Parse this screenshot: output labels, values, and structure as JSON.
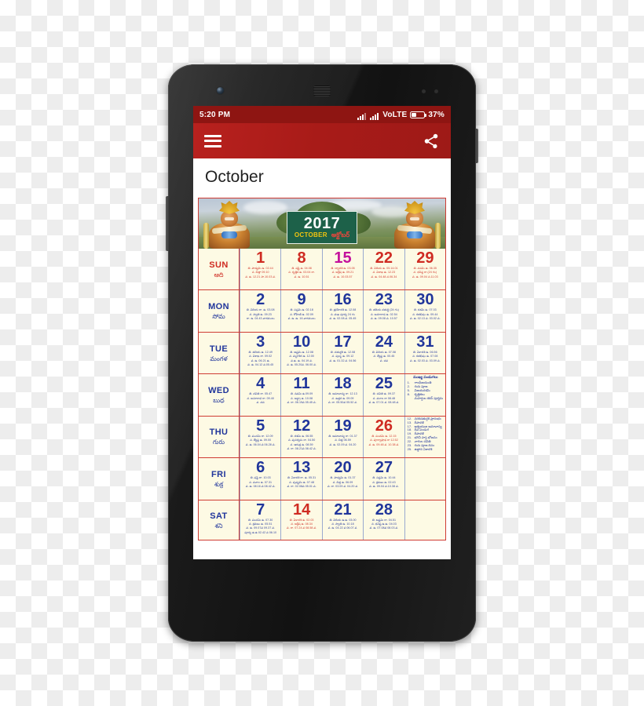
{
  "status_bar": {
    "time": "5:20 PM",
    "network_label": "VoLTE",
    "battery_percent": "37%",
    "signal_icon": "signal-bars-icon",
    "battery_icon": "battery-icon"
  },
  "app_bar": {
    "menu_icon": "hamburger-menu-icon",
    "share_icon": "share-icon",
    "background_color": "#b8211e"
  },
  "header": {
    "month_title": "October"
  },
  "banner": {
    "year": "2017",
    "month_english": "OCTOBER",
    "month_telugu": "అక్టోబర్",
    "left_deity": "hanuman-figure",
    "right_deity": "hanuman-figure",
    "plate_color": "#1d6149"
  },
  "calendar": {
    "border_color": "#cf3b33",
    "paper_color": "#fdfae4",
    "rows": [
      {
        "abbr": "SUN",
        "telugu": "ఆది",
        "label_color": "red",
        "cells": [
          {
            "date": "1",
            "color": "red",
            "lines": [
              "తి. పాడ్యమి ఉ. 02.44",
              "న. చిత్తా  09.10",
              "వ. ఉ. 12.21 సా.10.03 వ."
            ]
          },
          {
            "date": "8",
            "color": "red",
            "lines": [
              "తి. షష్టి  ఉ. 04.08",
              "న. కృత్తిక ఉ. 03.04 రా.",
              "వ. ఉ. 10.51"
            ]
          },
          {
            "date": "15",
            "color": "magenta",
            "lines": [
              "తి. ద్వాదశి ఉ. 03.05",
              "న. అశ్లేష ఉ. 09.21",
              "వ. ఉ. 10.03.57"
            ]
          },
          {
            "date": "22",
            "color": "red",
            "lines": [
              "తి. విదియ  ఉ. 05.14.01",
              "న. విశాఖ ఉ. 12.23",
              "వ. ఉ. 04.48 న.06.34"
            ]
          },
          {
            "date": "29",
            "color": "red",
            "lines": [
              "తి. నవమి ఉ. 06.35",
              "న. ధనిష్ఠ రా.(24 గం)",
              "వ. ఉ. 09.04 న.11.03"
            ]
          }
        ]
      },
      {
        "abbr": "MON",
        "telugu": "సోమ",
        "label_color": "blue",
        "cells": [
          {
            "date": "2",
            "color": "blue",
            "lines": [
              "తి. విదియ  రా. ఉ. 03.08",
              "న. స్వాతి ఉ. 09.23",
              "రా. ఉ. 04.43 వారములు"
            ]
          },
          {
            "date": "9",
            "color": "blue",
            "lines": [
              "తి. సప్తమి ఉ. 02.18",
              "న. రోహిణి ఉ. 02.09",
              "వ. ఉ. ఉ. 16 వారములు"
            ]
          },
          {
            "date": "16",
            "color": "blue",
            "lines": [
              "తి. త్రయోదశి ఉ. 12.08",
              "న. మఖ పూర్వ 24 గం",
              "వ. ఉ. 02.08 వ. 05.45"
            ]
          },
          {
            "date": "23",
            "color": "blue",
            "lines": [
              "తి. తదియ చతుర్థి  (24 గం)",
              "న. అనూరాధ ఉ. 02.54",
              "వ. ఉ. 09.08 వ. 10.57"
            ]
          },
          {
            "date": "30",
            "color": "blue",
            "lines": [
              "తి. దశమి  ఉ. 07.03",
              "న. శతభిషం ఉ. 09.44",
              "వ. ఉ. 02.13 వ. 03.02 వ."
            ]
          }
        ]
      },
      {
        "abbr": "TUE",
        "telugu": "మంగళ",
        "label_color": "blue",
        "cells": [
          {
            "date": "3",
            "color": "blue",
            "lines": [
              "తి. తదియ  ఉ. 12.49",
              "న. విశాఖ రా. 09.02",
              "వ. ఉ. 06.21 ఉ.",
              "వ. ఉ. 04.12 వ.05.45"
            ]
          },
          {
            "date": "10",
            "color": "blue",
            "lines": [
              "తి. అష్టమి ఉ. 12.08",
              "న. మృగశిర ఉ. 12.00",
              "వ.ఉ. ఉ. 04.19 వ.",
              "వ. ఉ. 05.20వ. 06.00 వ."
            ]
          },
          {
            "date": "17",
            "color": "blue",
            "lines": [
              "తి. చతుర్దశి ఉ. 12.08",
              "న. పుబ్బ ఉ. 09.12",
              "వ. ఉ. 01.32 వ. 04.56"
            ]
          },
          {
            "date": "24",
            "color": "blue",
            "lines": [
              "తి. విదియ ఉ. 07.08",
              "న. జ్యేష్ఠ ఉ. 00.45",
              "వ. చవ"
            ]
          },
          {
            "date": "31",
            "color": "blue",
            "lines": [
              "తి. ఏకాదశి  ఉ. 06.56",
              "న. శతభిషం ఉ. 07.08",
              "వ. ఉ. 02.03 వ. 03.09 వ."
            ]
          }
        ]
      },
      {
        "abbr": "WED",
        "telugu": "బుధ",
        "label_color": "blue",
        "cells": [
          {
            "date": "4",
            "color": "blue",
            "lines": [
              "తి. చవితి  రా. 05.47",
              "న. అనూరాధ రా. 09.40",
              "వ. చవ"
            ]
          },
          {
            "date": "11",
            "color": "blue",
            "lines": [
              "తి. నవమి ఉ.09.09",
              "న. ఆర్ద్రా ఉ. 10.08",
              "వ. రా. 06.19వ 05.45 వ."
            ]
          },
          {
            "date": "18",
            "color": "blue",
            "lines": [
              "తి. అమావాస్య రా. 12.13",
              "న. ఉత్తర ఉ. 09.09",
              "వ. రా. 05.50వ 05.52 వ."
            ]
          },
          {
            "date": "25",
            "color": "blue",
            "lines": [
              "తి. చవితి  ఉ. 09.37",
              "న. మూల రా 08.48",
              "వ. ఉ. 07.01 వ. 08.48 వ."
            ]
          }
        ]
      },
      {
        "abbr": "THU",
        "telugu": "గురు",
        "label_color": "blue",
        "cells": [
          {
            "date": "5",
            "color": "blue",
            "lines": [
              "తి. పంచమి  రా. 12.09",
              "న. జ్యేష్ఠ ఉ. 09.00",
              "వ. ఉ. 06.04 వ 06.28 వ."
            ]
          },
          {
            "date": "12",
            "color": "blue",
            "lines": [
              "తి. దశమి  ఉ. 06.55",
              "న. పునర్వసు రా. 04.50",
              "న. ఆరుద్ర ఉ. 08.59",
              "వ. రా. 08.21వ 08.42 వ."
            ]
          },
          {
            "date": "19",
            "color": "blue",
            "lines": [
              "తి. అమావాస్య  రా. 01.37",
              "న. చిత్త 06.59",
              "వ. ఉ. 02.09 వ. 04.20"
            ]
          },
          {
            "date": "26",
            "color": "red",
            "lines": [
              "తి. పంచమి  ఉ. 12.15",
              "న. పూర్వాషాఢ రా 12.52",
              "వ. ఉ. 09.48 వ. 10.38 వ."
            ]
          }
        ]
      },
      {
        "abbr": "FRI",
        "telugu": "శుక్ర",
        "label_color": "blue",
        "cells": [
          {
            "date": "6",
            "color": "blue",
            "lines": [
              "తి. షష్ఠి  రా. 10.03",
              "న. మూల ఉ. 07.31",
              "వ. ఉ. 08.16 వ 08.42 వ."
            ]
          },
          {
            "date": "13",
            "color": "blue",
            "lines": [
              "తి. ఏకాదశి రా. ఉ. 05.31",
              "న. పుష్యమి  ఉ. 07.48",
              "వ. రా. 02.08వ 05.01 వ."
            ]
          },
          {
            "date": "20",
            "color": "blue",
            "lines": [
              "తి. పాడ్యమి ఉ. 01.37",
              "న. చిత్త ఉ. 06.09",
              "వ. రా. 03.09 వ. 04.20 వ."
            ]
          },
          {
            "date": "27",
            "color": "blue",
            "lines": [
              "తి. సప్తమి ఉ. 10.44",
              "న. శ్రవణం ఉ. 02.43",
              "వ. ఉ. 09.04 వ.10.38 వ."
            ]
          }
        ]
      },
      {
        "abbr": "SAT",
        "telugu": "శని",
        "label_color": "blue",
        "cells": [
          {
            "date": "7",
            "color": "blue",
            "lines": [
              "తి. పంచమి  ఉ. 07.30",
              "న. శ్రవణం ఉ. 05.51",
              "వ. ఉ. 09.07వ 09.37 వ.",
              "పూర్వ ఉ.ఉ 02.42 వ 06.10"
            ]
          },
          {
            "date": "14",
            "color": "red",
            "lines": [
              "తి. ఏకాదశి  ఉ. 02.03",
              "న. ఆశ్లేష ఉ. 08.34",
              "వ. రా. 07.24 వ 08.58 వ."
            ]
          },
          {
            "date": "21",
            "color": "blue",
            "lines": [
              "తి. విదియ  ఉ.ఉ. 03.00",
              "న. స్వాతి ఉ. 10.18",
              "వ. ఉ. 04.22 వ 06.07 వ."
            ]
          },
          {
            "date": "28",
            "color": "blue",
            "lines": [
              "తి. అష్టమి  రా. 04.51",
              "న. ధనిష్ఠ ఉ.ఉ. 04.03",
              "వ. ఉ. 07.08వ 08.03 వ."
            ]
          }
        ]
      }
    ],
    "festivals": {
      "title": "ముఖ్య పండుగలు",
      "items": [
        {
          "n": "1.",
          "text": "గాంధీజయంతి"
        },
        {
          "n": "2.",
          "text": "గురు పూజ"
        },
        {
          "n": "5.",
          "text": "విజయదశమి"
        },
        {
          "n": "8.",
          "text": "కృత్తికలు"
        },
        {
          "n": "",
          "text": "మహర్షుల శరద్ పూర్ణిమ"
        },
        {
          "n": "12.",
          "text": "నరకచతుర్దశి ప్రారంభం"
        },
        {
          "n": "13.",
          "text": "దీపావళి"
        },
        {
          "n": "17.",
          "text": "ఆశ్వయుజ అమావాస్య"
        },
        {
          "n": "18.",
          "text": "దీప పండుగ"
        },
        {
          "n": "19.",
          "text": "దీపావళి"
        },
        {
          "n": "21.",
          "text": "భగినీ హస్త భోజనం"
        },
        {
          "n": "22.",
          "text": "నాగుల చవితి"
        },
        {
          "n": "23.",
          "text": "గురు పూజ దినం"
        },
        {
          "n": "25.",
          "text": "ఉత్థాన ఏకాదశి"
        }
      ]
    }
  }
}
